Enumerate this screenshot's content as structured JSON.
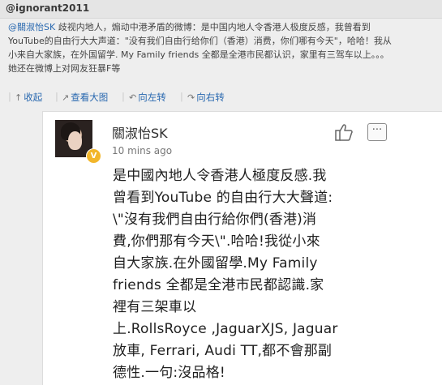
{
  "header": {
    "handle": "@ignorant2011"
  },
  "post": {
    "mention": "@關淑怡SK",
    "lines": [
      " 歧视内地人，煽动中港矛盾的微博：是中国内地人令香港人极度反感，我曾看到",
      "YouTube的自由行大大声道：\"没有我们自由行给你们（香港）消费，你们哪有今天\"，哈哈！我从",
      "小来自大家族，在外国留学. My Family friends 全都是全港市民都认识，家里有三驾车以上。。。",
      "她还在微博上对网友狂暴F等"
    ]
  },
  "actions": [
    {
      "icon": "↑",
      "label": "收起"
    },
    {
      "icon": "↗",
      "label": "查看大图"
    },
    {
      "icon": "↶",
      "label": "向左转"
    },
    {
      "icon": "↷",
      "label": "向右转"
    }
  ],
  "embed": {
    "user_name": "關淑怡SK",
    "time": "10 mins ago",
    "badge": "V",
    "more_icon": "···",
    "text_lines": [
      "是中國內地人令香港人極度反感.我",
      "曾看到YouTube 的自由行大大聲道:",
      "\\\"沒有我們自由行給你們(香港)消",
      "費,你們那有今天\\\".哈哈!我從小來",
      "自大家族.在外國留學.My Family",
      "friends 全都是全港市民都認識.家",
      "裡有三架車以",
      "上.RollsRoyce ,JaguarXJS, Jaguar",
      "放車, Ferrari, Audi TT,都不會那副",
      "德性.一句:沒品格!"
    ]
  },
  "colors": {
    "link": "#2a69b0",
    "badge": "#f2b62b",
    "background": "#eeeeee"
  }
}
